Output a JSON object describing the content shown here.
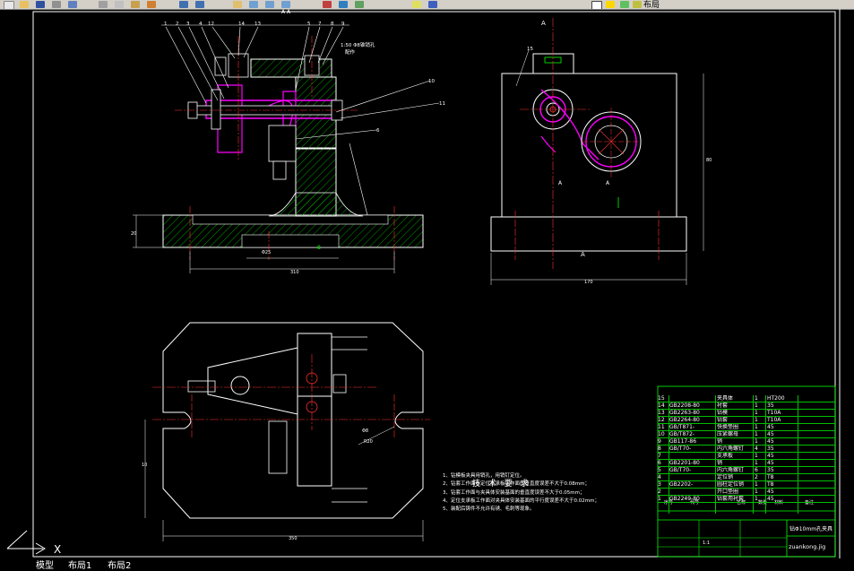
{
  "toolbar": {
    "right_text": "布局"
  },
  "drawing": {
    "section_label": "A-A",
    "view_label_a": "A",
    "callouts_left": [
      "1",
      "2",
      "3",
      "4",
      "12",
      "14",
      "13",
      "5",
      "7",
      "8",
      "9"
    ],
    "callouts_right": [
      "10",
      "11"
    ],
    "callout_15": "15",
    "taper_note": "1:50 Φ8锥销孔",
    "taper_note2": "配作",
    "dim_width_front": "310",
    "dim_width_side": "170",
    "dim_width_plan": "350",
    "dim_height_base": "20",
    "dim_height_side": "80",
    "dim_plan_height": "10",
    "dim_r20": "R20",
    "dim_phi": "Φ8"
  },
  "tech_requirements": {
    "title": "技 术 要 求",
    "items": [
      "1、钻模板夹具用销孔，用销钉定位。",
      "2、钻套工作面与定位支承板工作面的垂直度误差不大于0.08mm；",
      "3、钻套工作面与夹具体安装基面的垂直度误差不大于0.05mm；",
      "4、定位支承板工作面对夹具体安装基面的平行度误差不大于0.02mm；",
      "5、装配后铸件不允许有锈、毛刺等现象。"
    ]
  },
  "bom": {
    "rows": [
      {
        "no": "15",
        "code": "",
        "name": "夹具体",
        "qty": "1",
        "mat": "HT200"
      },
      {
        "no": "14",
        "code": "GB2208-80",
        "name": "衬套",
        "qty": "1",
        "mat": "35"
      },
      {
        "no": "13",
        "code": "GB2263-80",
        "name": "钻模",
        "qty": "1",
        "mat": "T10A"
      },
      {
        "no": "12",
        "code": "GB2264-80",
        "name": "钻套",
        "qty": "1",
        "mat": "T10A"
      },
      {
        "no": "11",
        "code": "GB/T871-",
        "name": "快换垫圈",
        "qty": "1",
        "mat": "45"
      },
      {
        "no": "10",
        "code": "GB/T872-",
        "name": "压紧螺母",
        "qty": "1",
        "mat": "45"
      },
      {
        "no": "9",
        "code": "GB117-86",
        "name": "销",
        "qty": "1",
        "mat": "45"
      },
      {
        "no": "8",
        "code": "GB/T70-",
        "name": "内六角螺钉",
        "qty": "4",
        "mat": "35"
      },
      {
        "no": "7",
        "code": "",
        "name": "支承板",
        "qty": "1",
        "mat": "45"
      },
      {
        "no": "6",
        "code": "GB2201-80",
        "name": "销",
        "qty": "1",
        "mat": "45"
      },
      {
        "no": "5",
        "code": "GB/T70-",
        "name": "内六角螺钉",
        "qty": "6",
        "mat": "35"
      },
      {
        "no": "4",
        "code": "",
        "name": "定位销",
        "qty": "2",
        "mat": "T8"
      },
      {
        "no": "3",
        "code": "GB2202-",
        "name": "圆柱定位销",
        "qty": "1",
        "mat": "T8"
      },
      {
        "no": "2",
        "code": "",
        "name": "开口垫圈",
        "qty": "1",
        "mat": "45"
      },
      {
        "no": "1",
        "code": "GB2249-80",
        "name": "钻套用衬套",
        "qty": "1",
        "mat": "45"
      }
    ],
    "header": {
      "no": "序号",
      "code": "代号",
      "name": "名称",
      "qty": "数量",
      "mat": "材料",
      "note": "备注"
    },
    "title_name": "钻Φ10mm孔夹具",
    "title_code": "zuankong.jig",
    "scale": "1:1"
  },
  "tabs": [
    "模型",
    "布局1",
    "布局2"
  ],
  "ucs": {
    "x_label": "X"
  }
}
